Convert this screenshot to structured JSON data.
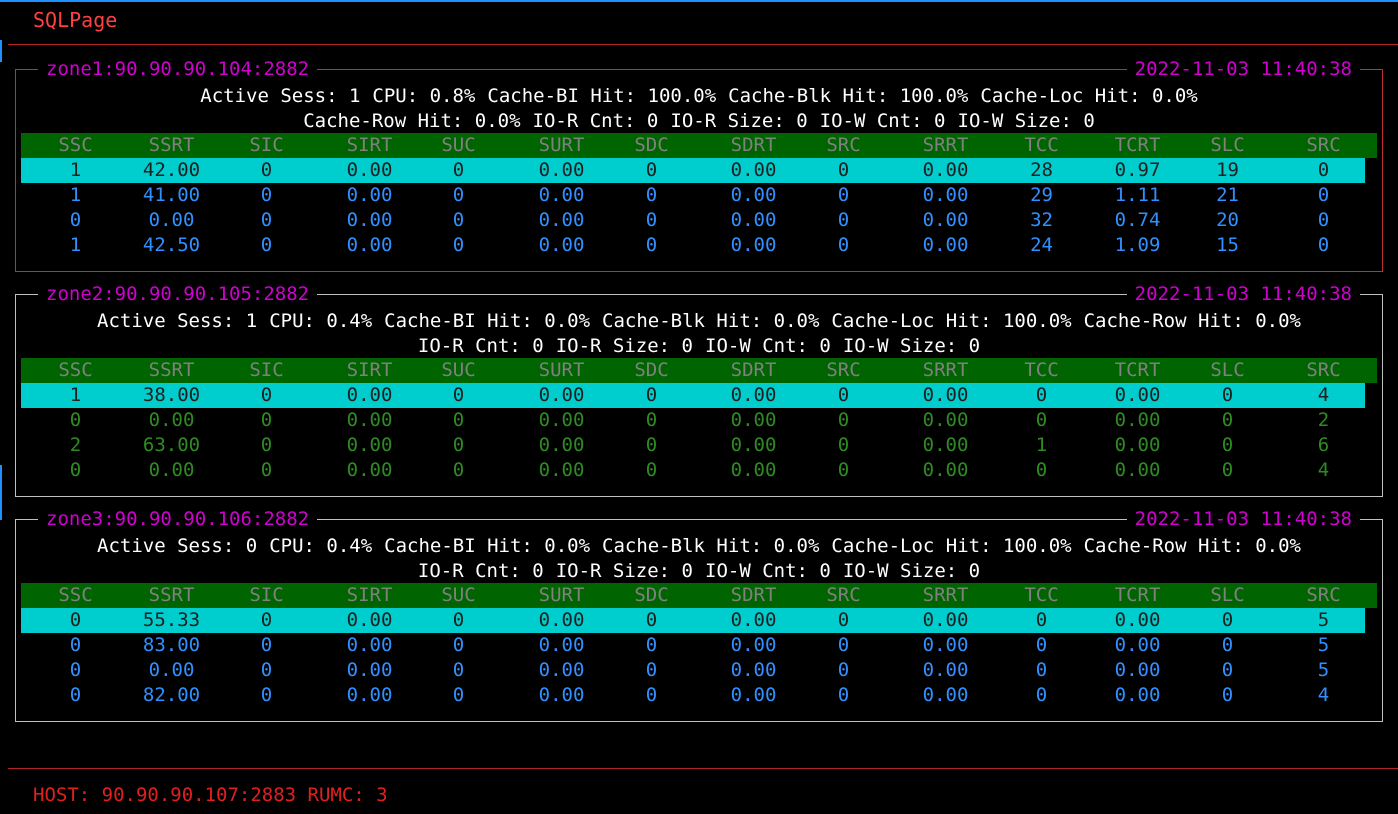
{
  "app": {
    "title": "SQLPage"
  },
  "columns": [
    "SSC",
    "SSRT",
    "SIC",
    "SIRT",
    "SUC",
    "SURT",
    "SDC",
    "SDRT",
    "SRC",
    "SRRT",
    "TCC",
    "TCRT",
    "SLC",
    "SRC"
  ],
  "zones": [
    {
      "name": "zone1:90.90.90.104:2882",
      "timestamp": "2022-11-03 11:40:38",
      "stats_line1": [
        "Active Sess: 1",
        "CPU: 0.8%",
        "Cache-BI Hit: 100.0%",
        "Cache-Blk Hit: 100.0%",
        "Cache-Loc Hit: 0.0%"
      ],
      "stats_line2": [
        "Cache-Row Hit: 0.0%",
        "IO-R Cnt: 0",
        "IO-R Size: 0",
        "IO-W Cnt: 0",
        "IO-W Size: 0"
      ],
      "row_color": "blue",
      "rows": [
        [
          "1",
          "42.00",
          "0",
          "0.00",
          "0",
          "0.00",
          "0",
          "0.00",
          "0",
          "0.00",
          "28",
          "0.97",
          "19",
          "0"
        ],
        [
          "1",
          "41.00",
          "0",
          "0.00",
          "0",
          "0.00",
          "0",
          "0.00",
          "0",
          "0.00",
          "29",
          "1.11",
          "21",
          "0"
        ],
        [
          "0",
          "0.00",
          "0",
          "0.00",
          "0",
          "0.00",
          "0",
          "0.00",
          "0",
          "0.00",
          "32",
          "0.74",
          "20",
          "0"
        ],
        [
          "1",
          "42.50",
          "0",
          "0.00",
          "0",
          "0.00",
          "0",
          "0.00",
          "0",
          "0.00",
          "24",
          "1.09",
          "15",
          "0"
        ]
      ]
    },
    {
      "name": "zone2:90.90.90.105:2882",
      "timestamp": "2022-11-03 11:40:38",
      "stats_line1": [
        "Active Sess: 1",
        "CPU: 0.4%",
        "Cache-BI Hit: 0.0%",
        "Cache-Blk Hit: 0.0%",
        "Cache-Loc Hit: 100.0%",
        "Cache-Row Hit: 0.0%"
      ],
      "stats_line2": [
        "IO-R Cnt: 0",
        "IO-R Size: 0",
        "IO-W Cnt: 0",
        "IO-W Size: 0"
      ],
      "row_color": "green",
      "rows": [
        [
          "1",
          "38.00",
          "0",
          "0.00",
          "0",
          "0.00",
          "0",
          "0.00",
          "0",
          "0.00",
          "0",
          "0.00",
          "0",
          "4"
        ],
        [
          "0",
          "0.00",
          "0",
          "0.00",
          "0",
          "0.00",
          "0",
          "0.00",
          "0",
          "0.00",
          "0",
          "0.00",
          "0",
          "2"
        ],
        [
          "2",
          "63.00",
          "0",
          "0.00",
          "0",
          "0.00",
          "0",
          "0.00",
          "0",
          "0.00",
          "1",
          "0.00",
          "0",
          "6"
        ],
        [
          "0",
          "0.00",
          "0",
          "0.00",
          "0",
          "0.00",
          "0",
          "0.00",
          "0",
          "0.00",
          "0",
          "0.00",
          "0",
          "4"
        ]
      ]
    },
    {
      "name": "zone3:90.90.90.106:2882",
      "timestamp": "2022-11-03 11:40:38",
      "stats_line1": [
        "Active Sess: 0",
        "CPU: 0.4%",
        "Cache-BI Hit: 0.0%",
        "Cache-Blk Hit: 0.0%",
        "Cache-Loc Hit: 100.0%",
        "Cache-Row Hit: 0.0%"
      ],
      "stats_line2": [
        "IO-R Cnt: 0",
        "IO-R Size: 0",
        "IO-W Cnt: 0",
        "IO-W Size: 0"
      ],
      "row_color": "blue",
      "rows": [
        [
          "0",
          "55.33",
          "0",
          "0.00",
          "0",
          "0.00",
          "0",
          "0.00",
          "0",
          "0.00",
          "0",
          "0.00",
          "0",
          "5"
        ],
        [
          "0",
          "83.00",
          "0",
          "0.00",
          "0",
          "0.00",
          "0",
          "0.00",
          "0",
          "0.00",
          "0",
          "0.00",
          "0",
          "5"
        ],
        [
          "0",
          "0.00",
          "0",
          "0.00",
          "0",
          "0.00",
          "0",
          "0.00",
          "0",
          "0.00",
          "0",
          "0.00",
          "0",
          "5"
        ],
        [
          "0",
          "82.00",
          "0",
          "0.00",
          "0",
          "0.00",
          "0",
          "0.00",
          "0",
          "0.00",
          "0",
          "0.00",
          "0",
          "4"
        ]
      ]
    }
  ],
  "footer": {
    "host": "HOST: 90.90.90.107:2883 RUMC: 3"
  }
}
